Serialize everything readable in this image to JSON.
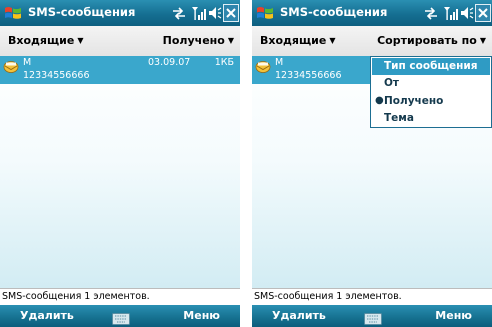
{
  "left_screen": {
    "title": "SMS-сообщения",
    "folder_menu": "Входящие",
    "sort_menu_label": "Получено",
    "message": {
      "sender": "M",
      "number": "12334556666",
      "date": "03.09.07",
      "size": "1КБ"
    },
    "status_text": "SMS-сообщения  1 элементов.",
    "softkey_left": "Удалить",
    "softkey_right": "Меню"
  },
  "right_screen": {
    "title": "SMS-сообщения",
    "folder_menu": "Входящие",
    "sort_menu_label": "Сортировать по",
    "message": {
      "sender": "M",
      "number": "12334556666"
    },
    "sort_options": [
      {
        "label": "Тип сообщения",
        "highlighted": true,
        "checked": false
      },
      {
        "label": "От",
        "highlighted": false,
        "checked": false
      },
      {
        "label": "Получено",
        "highlighted": false,
        "checked": true
      },
      {
        "label": "Тема",
        "highlighted": false,
        "checked": false
      }
    ],
    "status_text": "SMS-сообщения  1 элементов.",
    "softkey_left": "Удалить",
    "softkey_right": "Меню"
  },
  "icons": {
    "start": "windows-flag-icon",
    "sync": "sync-arrows-icon",
    "signal": "signal-strength-icon",
    "volume": "speaker-icon",
    "close": "close-icon",
    "message": "sms-envelope-icon",
    "keyboard": "keyboard-icon"
  },
  "colors": {
    "titlebar": "#156f92",
    "selection": "#3aa7cc",
    "menu_highlight": "#2f9bc4"
  }
}
